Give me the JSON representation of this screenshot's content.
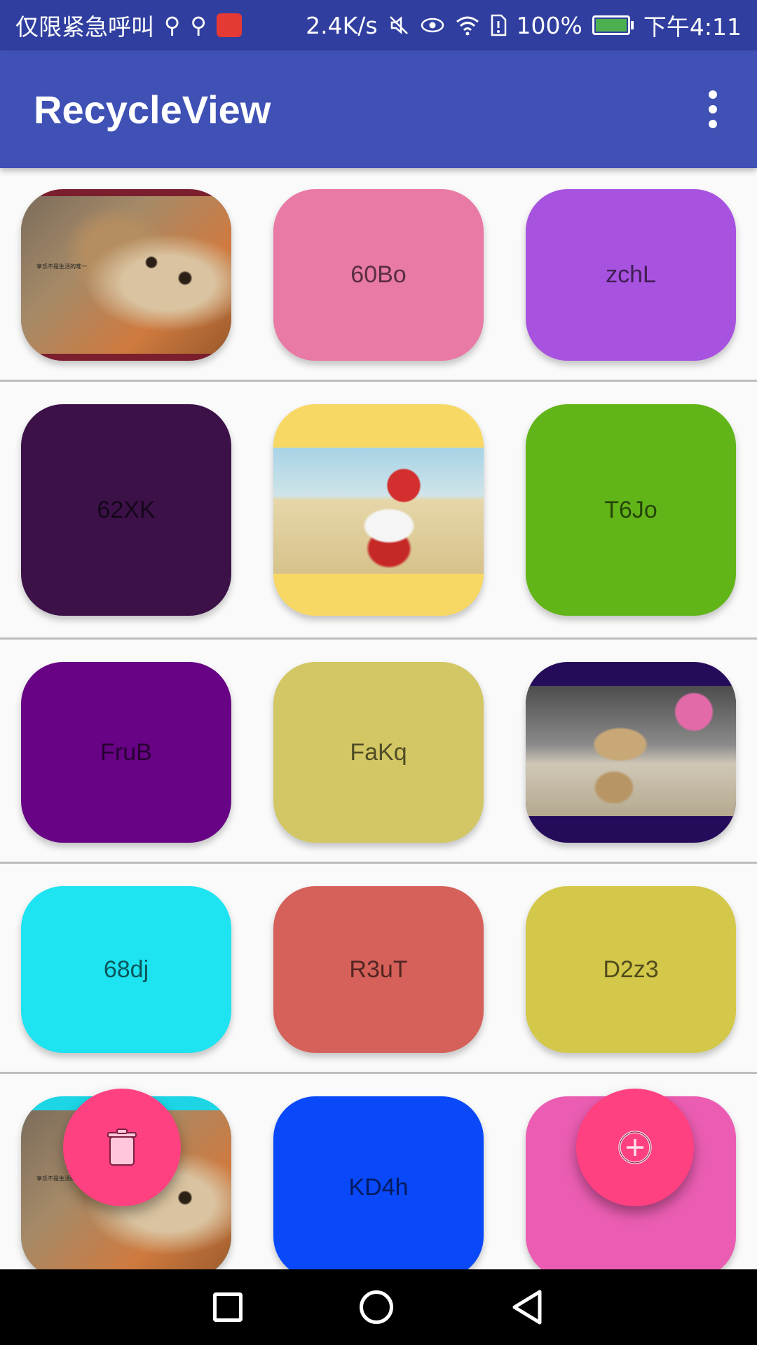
{
  "status_bar": {
    "carrier_text": "仅限紧急呼叫",
    "speed": "2.4K/s",
    "battery": "100%",
    "time": "下午4:11",
    "icons": [
      "usb-icon",
      "usb-icon",
      "app-notification-icon",
      "mute-icon",
      "eye-icon",
      "wifi-icon",
      "sim-icon",
      "battery-icon"
    ]
  },
  "app_bar": {
    "title": "RecycleView",
    "menu_icon": "overflow-menu-icon"
  },
  "grid": {
    "rows": [
      {
        "cards": [
          {
            "type": "image",
            "image": "cat photo",
            "caption": "享乐不是生活的唯一",
            "bg": "#7b1f2e"
          },
          {
            "type": "text",
            "label": "60Bo",
            "bg": "#e97aa5"
          },
          {
            "type": "text",
            "label": "zchL",
            "bg": "#a852e0"
          }
        ]
      },
      {
        "cards": [
          {
            "type": "text",
            "label": "62XK",
            "bg": "#3b1148"
          },
          {
            "type": "image",
            "image": "child with camera on beach",
            "bg": "#f8d864"
          },
          {
            "type": "text",
            "label": "T6Jo",
            "bg": "#62b519"
          }
        ]
      },
      {
        "cards": [
          {
            "type": "text",
            "label": "FruB",
            "bg": "#670384"
          },
          {
            "type": "text",
            "label": "FaKq",
            "bg": "#d2c764"
          },
          {
            "type": "image",
            "image": "danbo robot with flower",
            "bg": "#250c5a"
          }
        ]
      },
      {
        "cards": [
          {
            "type": "text",
            "label": "68dj",
            "bg": "#1ee3f0"
          },
          {
            "type": "text",
            "label": "R3uT",
            "bg": "#d6615a"
          },
          {
            "type": "text",
            "label": "D2z3",
            "bg": "#d3c84a"
          }
        ]
      },
      {
        "cards": [
          {
            "type": "image",
            "image": "cat photo",
            "caption": "享乐不是生活的",
            "bg": "#1dd5e5"
          },
          {
            "type": "text",
            "label": "KD4h",
            "bg": "#0a49fa"
          },
          {
            "type": "text",
            "label": "",
            "bg": "#eb5db2"
          }
        ]
      }
    ]
  },
  "fabs": {
    "delete_icon": "trash-icon",
    "add_icon": "add-circle-icon",
    "color": "#ff4081"
  },
  "nav_bar": {
    "icons": [
      "recents-icon",
      "home-icon",
      "back-icon"
    ]
  }
}
